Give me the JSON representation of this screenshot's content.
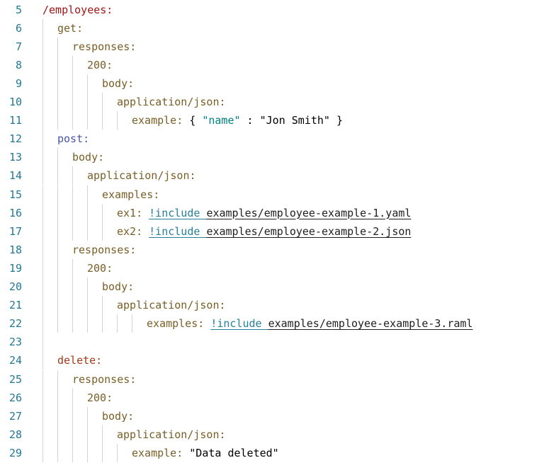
{
  "editor": {
    "colors": {
      "line_number": "#237893",
      "key": "#795e26",
      "http_method": "#4a55a8",
      "resource": "#a31515",
      "include_tag": "#267f99",
      "guide": "#d3d3d3"
    },
    "lines": [
      {
        "n": "5",
        "indent": 1,
        "guides": [],
        "tokens": [
          {
            "t": "/employees:",
            "c": "k-red",
            "name": "resource-key"
          }
        ]
      },
      {
        "n": "6",
        "indent": 2,
        "guides": [
          1
        ],
        "tokens": [
          {
            "t": "get:",
            "c": "k-olive",
            "name": "method-key-get"
          }
        ]
      },
      {
        "n": "7",
        "indent": 3,
        "guides": [
          1,
          2
        ],
        "tokens": [
          {
            "t": "responses:",
            "c": "k-olive",
            "name": "yaml-key"
          }
        ]
      },
      {
        "n": "8",
        "indent": 4,
        "guides": [
          1,
          2,
          3
        ],
        "tokens": [
          {
            "t": "200:",
            "c": "k-olive",
            "name": "status-code-key"
          }
        ]
      },
      {
        "n": "9",
        "indent": 5,
        "guides": [
          1,
          2,
          3,
          4
        ],
        "tokens": [
          {
            "t": "body:",
            "c": "k-olive",
            "name": "yaml-key"
          }
        ]
      },
      {
        "n": "10",
        "indent": 6,
        "guides": [
          1,
          2,
          3,
          4,
          5
        ],
        "tokens": [
          {
            "t": "application/json:",
            "c": "k-olive",
            "name": "media-type-key"
          }
        ]
      },
      {
        "n": "11",
        "indent": 7,
        "guides": [
          1,
          2,
          3,
          4,
          5,
          6
        ],
        "tokens": [
          {
            "t": "example: ",
            "c": "k-olive",
            "name": "yaml-key"
          },
          {
            "t": "{ ",
            "c": "punct",
            "name": "json-brace"
          },
          {
            "t": "\"name\"",
            "c": "kw-teal",
            "name": "json-key"
          },
          {
            "t": " : ",
            "c": "punct",
            "name": "json-colon"
          },
          {
            "t": "\"Jon Smith\"",
            "c": "jsonstr",
            "name": "json-string"
          },
          {
            "t": " }",
            "c": "punct",
            "name": "json-brace"
          }
        ]
      },
      {
        "n": "12",
        "indent": 2,
        "guides": [
          1
        ],
        "tokens": [
          {
            "t": "post:",
            "c": "k-blue",
            "name": "method-key-post"
          }
        ]
      },
      {
        "n": "13",
        "indent": 3,
        "guides": [
          1,
          2
        ],
        "tokens": [
          {
            "t": "body:",
            "c": "k-olive",
            "name": "yaml-key"
          }
        ]
      },
      {
        "n": "14",
        "indent": 4,
        "guides": [
          1,
          2,
          3
        ],
        "tokens": [
          {
            "t": "application/json:",
            "c": "k-olive",
            "name": "media-type-key"
          }
        ]
      },
      {
        "n": "15",
        "indent": 5,
        "guides": [
          1,
          2,
          3,
          4
        ],
        "tokens": [
          {
            "t": "examples:",
            "c": "k-olive",
            "name": "yaml-key"
          }
        ]
      },
      {
        "n": "16",
        "indent": 6,
        "guides": [
          1,
          2,
          3,
          4,
          5
        ],
        "tokens": [
          {
            "t": "ex1: ",
            "c": "k-olive",
            "name": "yaml-key"
          },
          {
            "t": "!include ",
            "c": "tag",
            "name": "include-tag"
          },
          {
            "t": "examples/employee-example-1.yaml",
            "c": "path",
            "name": "include-path-link"
          }
        ]
      },
      {
        "n": "17",
        "indent": 6,
        "guides": [
          1,
          2,
          3,
          4,
          5
        ],
        "tokens": [
          {
            "t": "ex2: ",
            "c": "k-olive",
            "name": "yaml-key"
          },
          {
            "t": "!include ",
            "c": "tag",
            "name": "include-tag"
          },
          {
            "t": "examples/employee-example-2.json",
            "c": "path",
            "name": "include-path-link"
          }
        ]
      },
      {
        "n": "18",
        "indent": 3,
        "guides": [
          1,
          2
        ],
        "tokens": [
          {
            "t": "responses:",
            "c": "k-olive",
            "name": "yaml-key"
          }
        ]
      },
      {
        "n": "19",
        "indent": 4,
        "guides": [
          1,
          2,
          3
        ],
        "tokens": [
          {
            "t": "200:",
            "c": "k-olive",
            "name": "status-code-key"
          }
        ]
      },
      {
        "n": "20",
        "indent": 5,
        "guides": [
          1,
          2,
          3,
          4
        ],
        "tokens": [
          {
            "t": "body:",
            "c": "k-olive",
            "name": "yaml-key"
          }
        ]
      },
      {
        "n": "21",
        "indent": 6,
        "guides": [
          1,
          2,
          3,
          4,
          5
        ],
        "tokens": [
          {
            "t": "application/json:",
            "c": "k-olive",
            "name": "media-type-key"
          }
        ]
      },
      {
        "n": "22",
        "indent": 8,
        "guides": [
          1,
          2,
          3,
          4,
          5,
          6,
          7
        ],
        "tokens": [
          {
            "t": "examples: ",
            "c": "k-olive",
            "name": "yaml-key"
          },
          {
            "t": "!include ",
            "c": "tag",
            "name": "include-tag"
          },
          {
            "t": "examples/employee-example-3.raml",
            "c": "path",
            "name": "include-path-link"
          }
        ]
      },
      {
        "n": "23",
        "indent": 1,
        "guides": [
          1
        ],
        "tokens": []
      },
      {
        "n": "24",
        "indent": 2,
        "guides": [
          1
        ],
        "tokens": [
          {
            "t": "delete:",
            "c": "k-maroon",
            "name": "method-key-delete"
          }
        ]
      },
      {
        "n": "25",
        "indent": 3,
        "guides": [
          1,
          2
        ],
        "tokens": [
          {
            "t": "responses:",
            "c": "k-olive",
            "name": "yaml-key"
          }
        ]
      },
      {
        "n": "26",
        "indent": 4,
        "guides": [
          1,
          2,
          3
        ],
        "tokens": [
          {
            "t": "200:",
            "c": "k-olive",
            "name": "status-code-key"
          }
        ]
      },
      {
        "n": "27",
        "indent": 5,
        "guides": [
          1,
          2,
          3,
          4
        ],
        "tokens": [
          {
            "t": "body:",
            "c": "k-olive",
            "name": "yaml-key"
          }
        ]
      },
      {
        "n": "28",
        "indent": 6,
        "guides": [
          1,
          2,
          3,
          4,
          5
        ],
        "tokens": [
          {
            "t": "application/json:",
            "c": "k-olive",
            "name": "media-type-key"
          }
        ]
      },
      {
        "n": "29",
        "indent": 7,
        "guides": [
          1,
          2,
          3,
          4,
          5,
          6
        ],
        "tokens": [
          {
            "t": "example: ",
            "c": "k-olive",
            "name": "yaml-key"
          },
          {
            "t": "\"Data deleted\"",
            "c": "jsonstr",
            "name": "string-value"
          }
        ]
      }
    ]
  }
}
